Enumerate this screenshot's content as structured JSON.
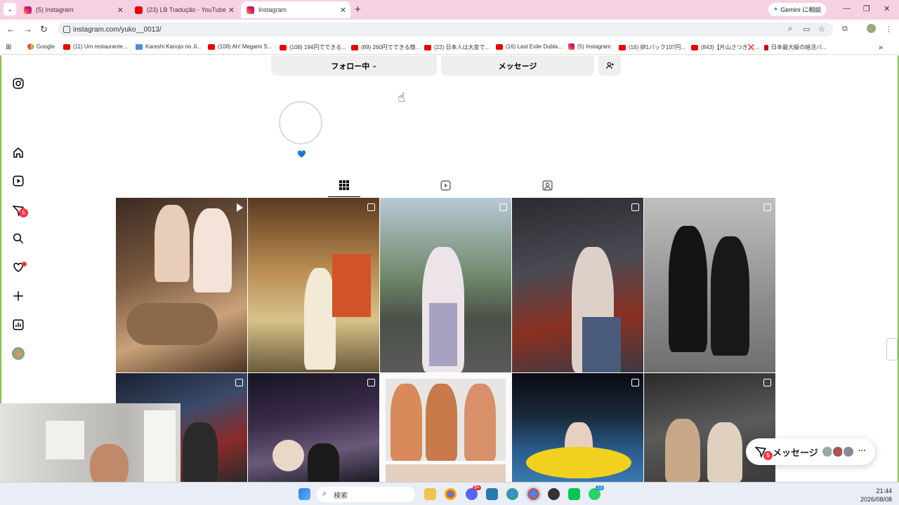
{
  "tabs": [
    {
      "title": "(5) Instagram",
      "icon": "instagram-favicon-icon"
    },
    {
      "title": "(23) LB Tradução - YouTube",
      "icon": "youtube-favicon-icon"
    },
    {
      "title": "Instagram",
      "icon": "instagram-favicon-icon",
      "active": true
    }
  ],
  "gemini": "Gemini に相談",
  "url": "instagram.com/yuko__0013/",
  "bookmarks": [
    "Google",
    "(11) Um restaurante...",
    "Kareshi Kanojo no Ji...",
    "(108) Ah! Megami S...",
    "(108) 194円でできる...",
    "(89) 260円でできる簡...",
    "(22) 日本人は大変で...",
    "(16) Last Exile Dubla...",
    "(5) Instagram",
    "(16) 卵1パック107円...",
    "(843)【片山さつき❌...",
    "日本最大級の暗活パ..."
  ],
  "profile": {
    "follow_label": "フォロー中",
    "message_label": "メッセージ",
    "story_heart": "💙"
  },
  "message_pill": {
    "label": "メッセージ",
    "badge": "5"
  },
  "sidebar_badge": "5",
  "taskbar": {
    "search_placeholder": "検索",
    "time": "21:44",
    "date": "2026/08/08",
    "badge_1": "9+",
    "badge_2": "23"
  },
  "colors": {
    "accent": "#ff3040",
    "tab_bg": "#f6d1e4",
    "story_ring": "#dbdbdb"
  }
}
